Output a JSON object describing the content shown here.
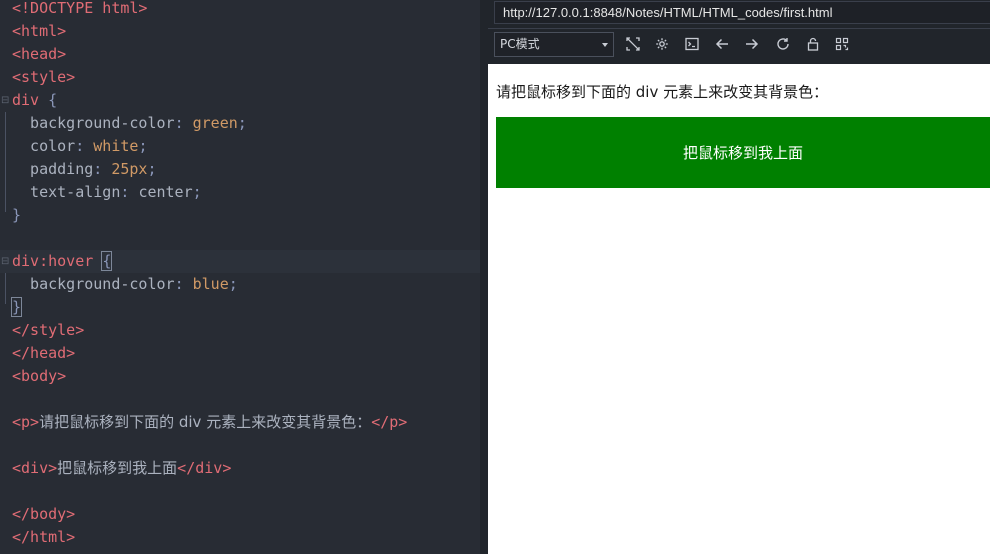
{
  "editor": {
    "lines": [
      {
        "parts": [
          [
            "tag",
            "<!DOCTYPE html>"
          ]
        ]
      },
      {
        "parts": [
          [
            "tag",
            "<html>"
          ]
        ]
      },
      {
        "parts": [
          [
            "tag",
            "<head>"
          ]
        ]
      },
      {
        "parts": [
          [
            "tag",
            "<style>"
          ]
        ]
      },
      {
        "parts": [
          [
            "sel",
            "div "
          ],
          [
            "brace",
            "{"
          ]
        ]
      },
      {
        "parts": [
          [
            "prop",
            "  background-color"
          ],
          [
            "brace",
            ": "
          ],
          [
            "val",
            "green"
          ],
          [
            "brace",
            ";"
          ]
        ]
      },
      {
        "parts": [
          [
            "prop",
            "  color"
          ],
          [
            "brace",
            ": "
          ],
          [
            "val",
            "white"
          ],
          [
            "brace",
            ";"
          ]
        ]
      },
      {
        "parts": [
          [
            "prop",
            "  padding"
          ],
          [
            "brace",
            ": "
          ],
          [
            "val",
            "25px"
          ],
          [
            "brace",
            ";"
          ]
        ]
      },
      {
        "parts": [
          [
            "prop",
            "  text-align"
          ],
          [
            "brace",
            ": "
          ],
          [
            "prop",
            "center"
          ],
          [
            "brace",
            ";"
          ]
        ]
      },
      {
        "parts": [
          [
            "brace",
            "}"
          ]
        ]
      },
      {
        "parts": []
      },
      {
        "parts": [
          [
            "sel",
            "div:hover "
          ],
          [
            "brace",
            "{"
          ]
        ]
      },
      {
        "parts": [
          [
            "prop",
            "  background-color"
          ],
          [
            "brace",
            ": "
          ],
          [
            "val",
            "blue"
          ],
          [
            "brace",
            ";"
          ]
        ]
      },
      {
        "parts": [
          [
            "brace",
            "}"
          ]
        ]
      },
      {
        "parts": [
          [
            "tag",
            "</style>"
          ]
        ]
      },
      {
        "parts": [
          [
            "tag",
            "</head>"
          ]
        ]
      },
      {
        "parts": [
          [
            "tag",
            "<body>"
          ]
        ]
      },
      {
        "parts": []
      },
      {
        "parts": [
          [
            "tag",
            "<p>"
          ],
          [
            "txt",
            "请把鼠标移到下面的 div 元素上来改变其背景色："
          ],
          [
            "tag",
            "</p>"
          ]
        ]
      },
      {
        "parts": []
      },
      {
        "parts": [
          [
            "tag",
            "<div>"
          ],
          [
            "txt",
            "把鼠标移到我上面"
          ],
          [
            "tag",
            "</div>"
          ]
        ]
      },
      {
        "parts": []
      },
      {
        "parts": [
          [
            "tag",
            "</body>"
          ]
        ]
      },
      {
        "parts": [
          [
            "tag",
            "</html>"
          ]
        ]
      }
    ]
  },
  "browser": {
    "url": "http://127.0.0.1:8848/Notes/HTML/HTML_codes/first.html",
    "mode_select": "PC模式",
    "toolbar_icons": [
      "screenshot-icon",
      "settings-icon",
      "console-icon",
      "back-arrow-icon",
      "forward-arrow-icon",
      "reload-icon",
      "lock-icon",
      "qrcode-icon"
    ],
    "page": {
      "paragraph": "请把鼠标移到下面的 div 元素上来改变其背景色：",
      "hover_div": "把鼠标移到我上面",
      "div_color": "#008000"
    }
  }
}
